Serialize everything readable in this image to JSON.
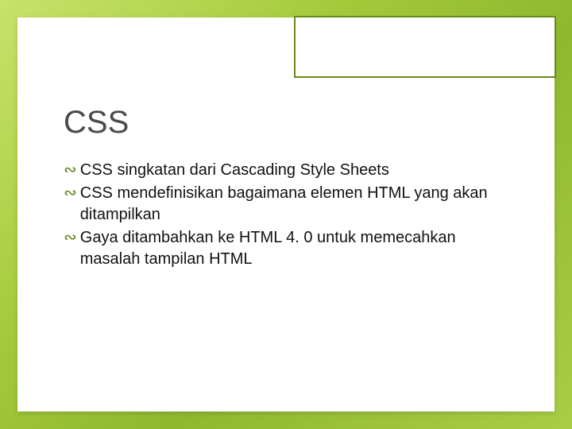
{
  "slide": {
    "title": "CSS",
    "bullets": [
      "CSS singkatan dari Cascading Style Sheets",
      "CSS mendefinisikan bagaimana elemen HTML yang akan ditampilkan",
      "Gaya ditambahkan ke HTML 4. 0 untuk memecahkan masalah tampilan HTML"
    ],
    "bullet_glyph": "∾"
  },
  "colors": {
    "accent": "#6a8a1a"
  }
}
